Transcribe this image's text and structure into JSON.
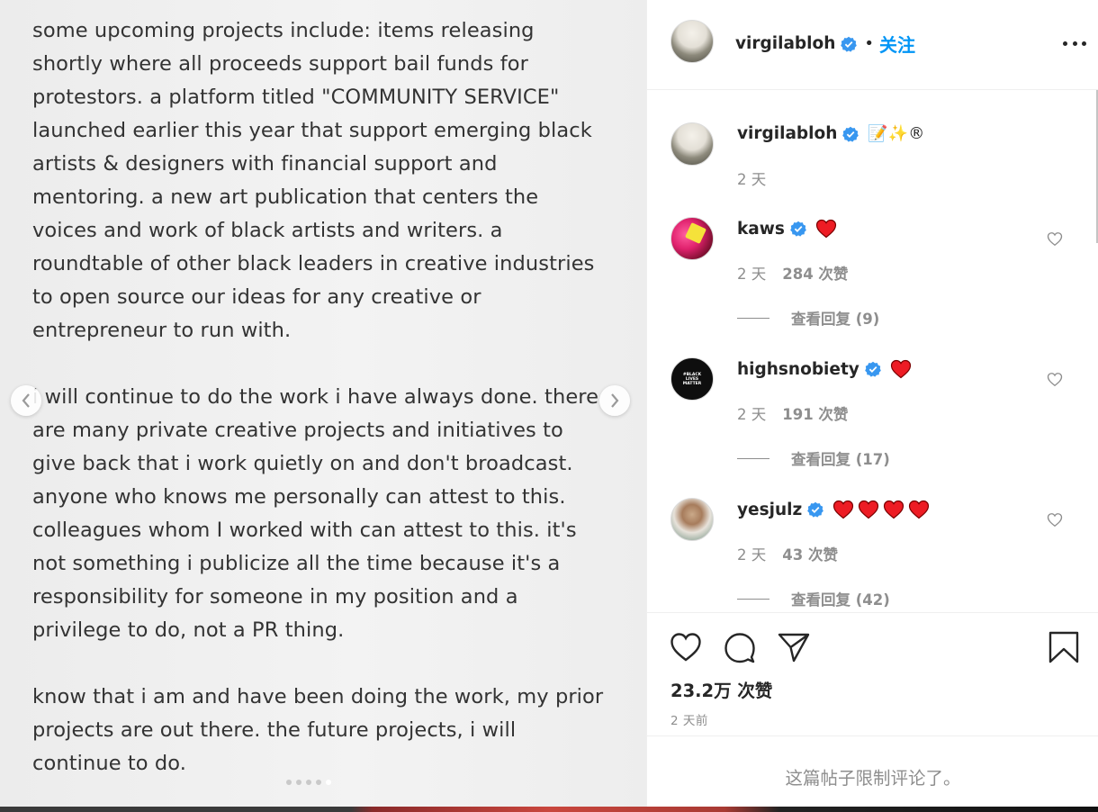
{
  "media": {
    "paragraphs": [
      "some upcoming projects include: items releasing\nshortly where all proceeds support bail funds for\nprotestors. a platform titled \"COMMUNITY SERVICE\"\nlaunched earlier this year that support emerging black\nartists & designers with financial support and\nmentoring. a new art publication that centers the\nvoices and work of black artists and writers. a\nroundtable of other black leaders in creative industries\nto open source our ideas for any creative or\nentrepreneur to run with.",
      "i will continue to do the work i have always done. there\nare many private creative projects and initiatives to\ngive back that i work quietly on and don't broadcast.\nanyone who knows me personally can attest to this.\ncolleagues whom I worked with can attest to this. it's\nnot something i publicize all the time because it's a\nresponsibility for someone in my position and a\nprivilege to do, not a PR thing.",
      "know that i am and have been doing the work, my prior\nprojects are out there. the future projects, i will\ncontinue to do."
    ],
    "dots_total": 5,
    "dots_active_index": 4
  },
  "header": {
    "username": "virgilabloh",
    "separator": "•",
    "follow_label": "关注",
    "avatar_icon": "virgilabloh-avatar"
  },
  "caption": {
    "username": "virgilabloh",
    "text": "📝✨®",
    "time": "2 天"
  },
  "comments": [
    {
      "username": "kaws",
      "hearts": 1,
      "time": "2 天",
      "likes": "284 次赞",
      "replies": "查看回复 (9)",
      "avatar_icon": "kaws-avatar"
    },
    {
      "username": "highsnobiety",
      "hearts": 1,
      "time": "2 天",
      "likes": "191 次赞",
      "replies": "查看回复 (17)",
      "avatar_icon": "black-lives-matter-avatar"
    },
    {
      "username": "yesjulz",
      "hearts": 4,
      "time": "2 天",
      "likes": "43 次赞",
      "replies": "查看回复 (42)",
      "avatar_icon": "yesjulz-avatar"
    }
  ],
  "highsnobiety_avatar_text": "#BLACK\nLIVES\nMATTER",
  "actions": {
    "likes": "23.2万 次赞",
    "time_ago": "2 天前",
    "comments_disabled": "这篇帖子限制评论了。"
  },
  "colors": {
    "accent": "#0095f6",
    "verified": "#3897f0",
    "heart": "#ed1c24",
    "muted": "#8e8e8e"
  }
}
